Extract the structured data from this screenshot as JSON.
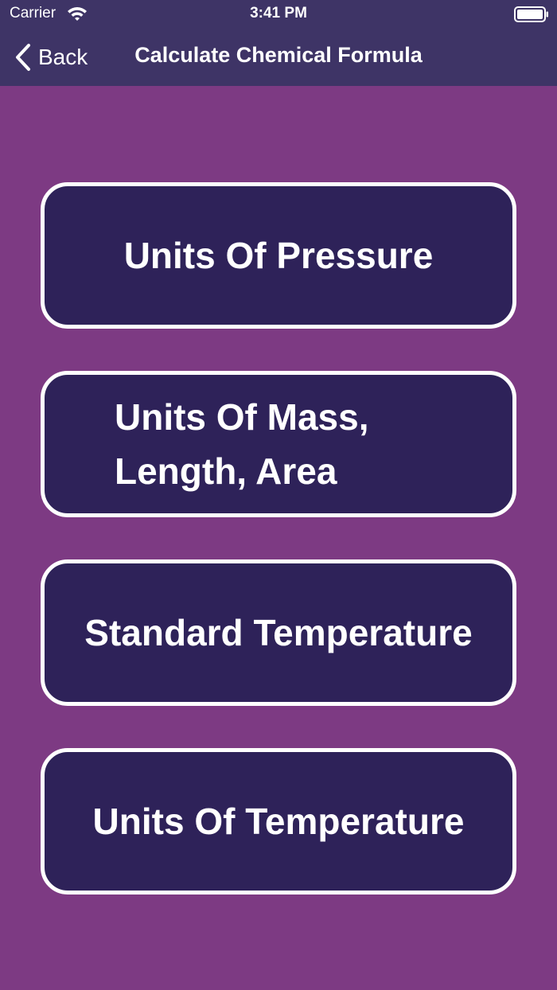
{
  "status_bar": {
    "carrier": "Carrier",
    "time": "3:41 PM",
    "wifi_icon": "wifi-icon",
    "battery_icon": "battery-icon"
  },
  "nav_bar": {
    "back_label": "Back",
    "back_icon": "chevron-left-icon",
    "title": "Calculate Chemical Formula"
  },
  "colors": {
    "background": "#7d3a83",
    "header": "#3e3466",
    "button_fill": "#2e2259",
    "button_border": "#ffffff",
    "text": "#ffffff"
  },
  "menu": {
    "items": [
      {
        "label": "Units Of Pressure"
      },
      {
        "label": "Units Of Mass, Length, Area"
      },
      {
        "label": "Standard Temperature"
      },
      {
        "label": "Units Of Temperature"
      }
    ]
  }
}
